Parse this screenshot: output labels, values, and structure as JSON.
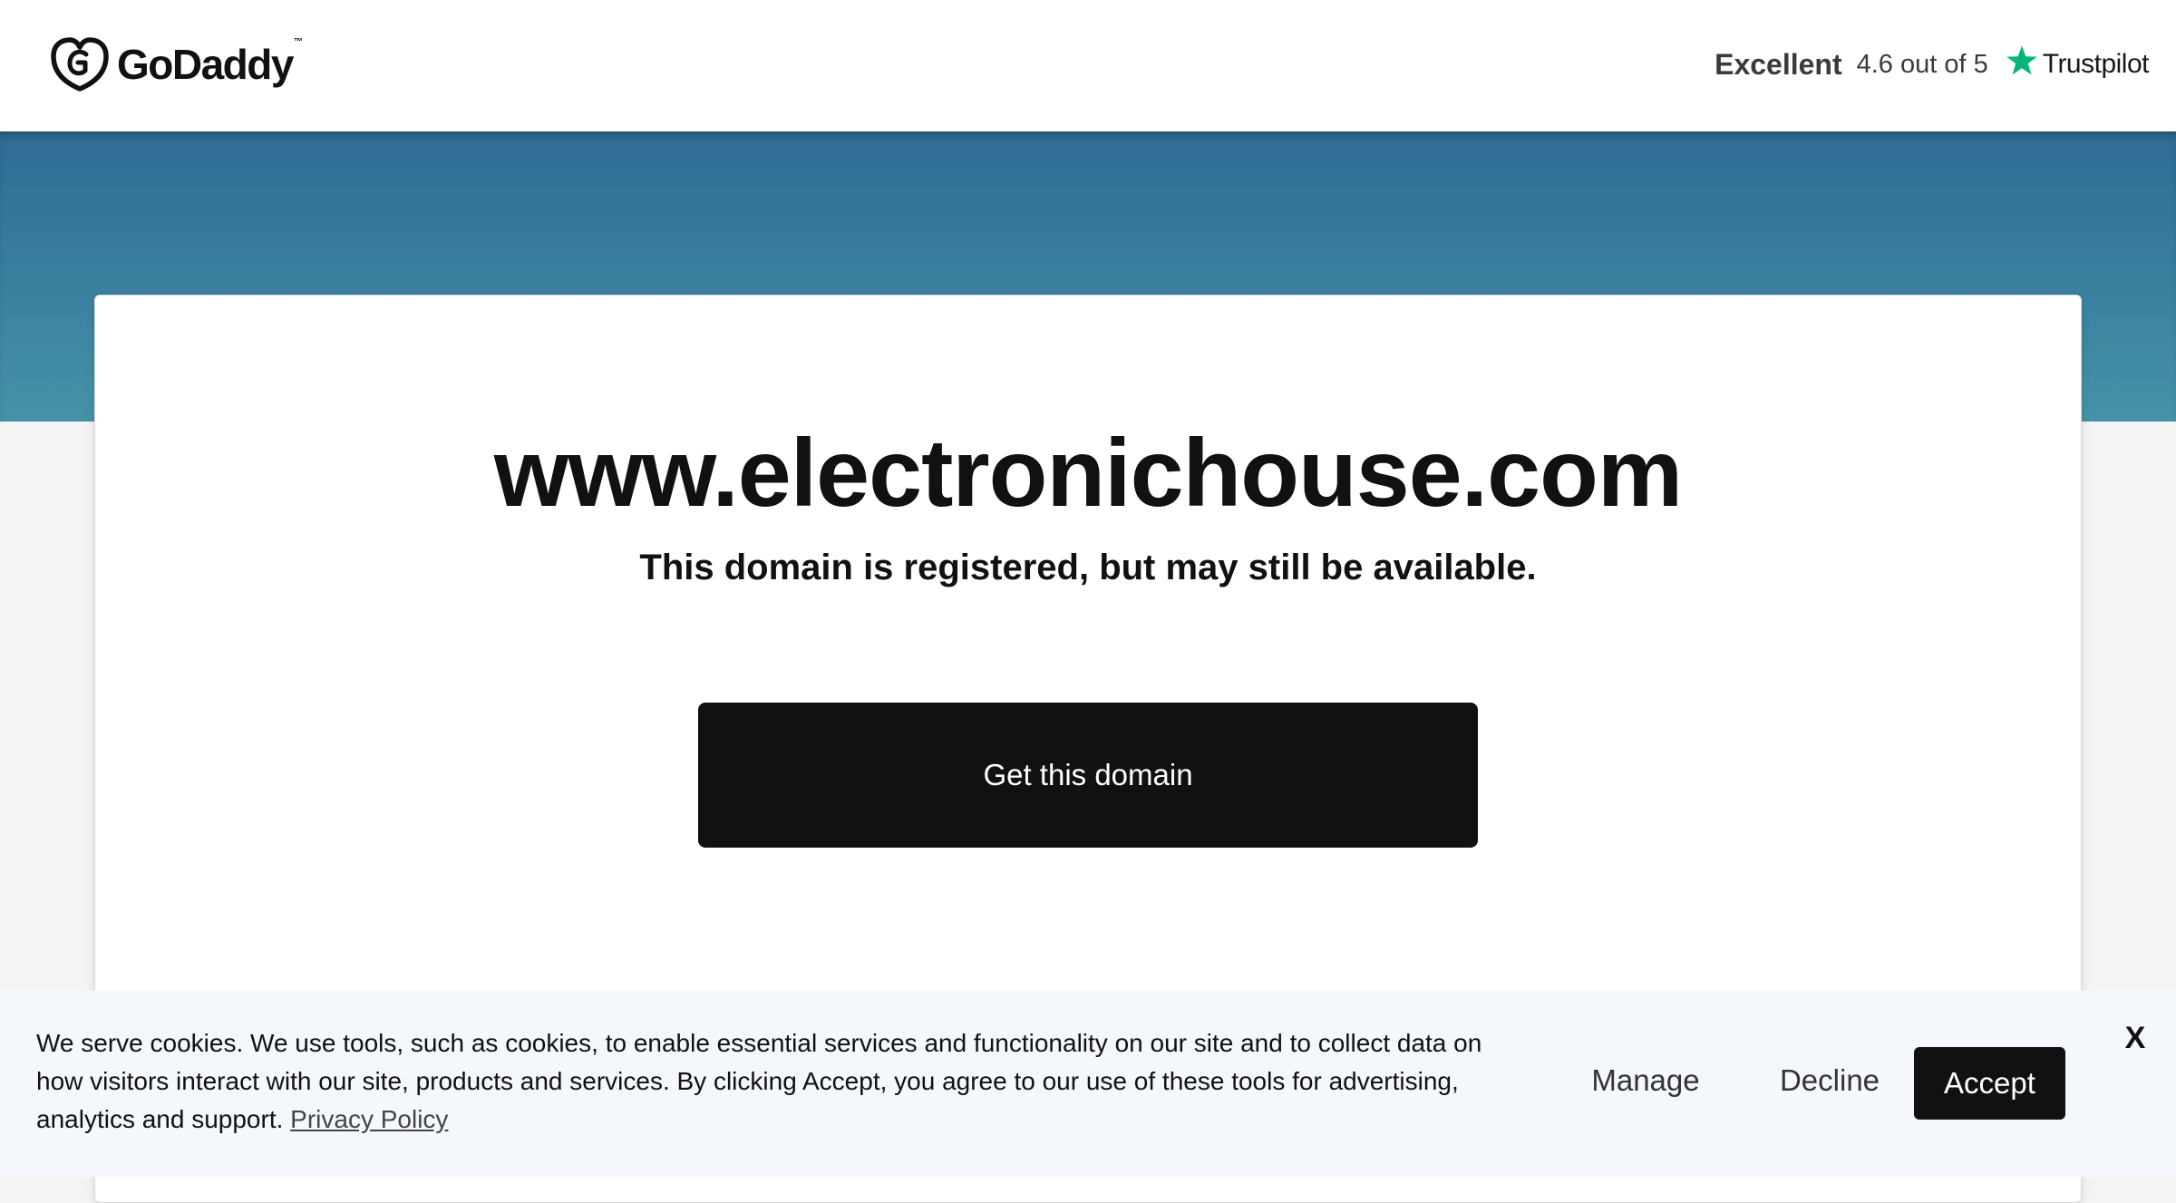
{
  "header": {
    "logo_text": "GoDaddy",
    "logo_tm": "™",
    "rating_label": "Excellent",
    "rating_score": "4.6 out of 5",
    "rating_brand": "Trustpilot",
    "rating_star_icon": "star-icon"
  },
  "main": {
    "domain": "www.electronichouse.com",
    "subtitle": "This domain is registered, but may still be available.",
    "cta_label": "Get this domain"
  },
  "cookie_banner": {
    "text": "We serve cookies. We use tools, such as cookies, to enable essential services and functionality on our site and to collect data on how visitors interact with our site, products and services. By clicking Accept, you agree to our use of these tools for advertising, analytics and support.",
    "privacy_link": "Privacy Policy",
    "manage_label": "Manage",
    "decline_label": "Decline",
    "accept_label": "Accept",
    "close_label": "X"
  },
  "colors": {
    "hero_top": "#2e6b94",
    "hero_bottom": "#4593a8",
    "trustpilot_green": "#00b67a",
    "primary_button": "#111111",
    "cookie_background": "#f4f7fb"
  }
}
